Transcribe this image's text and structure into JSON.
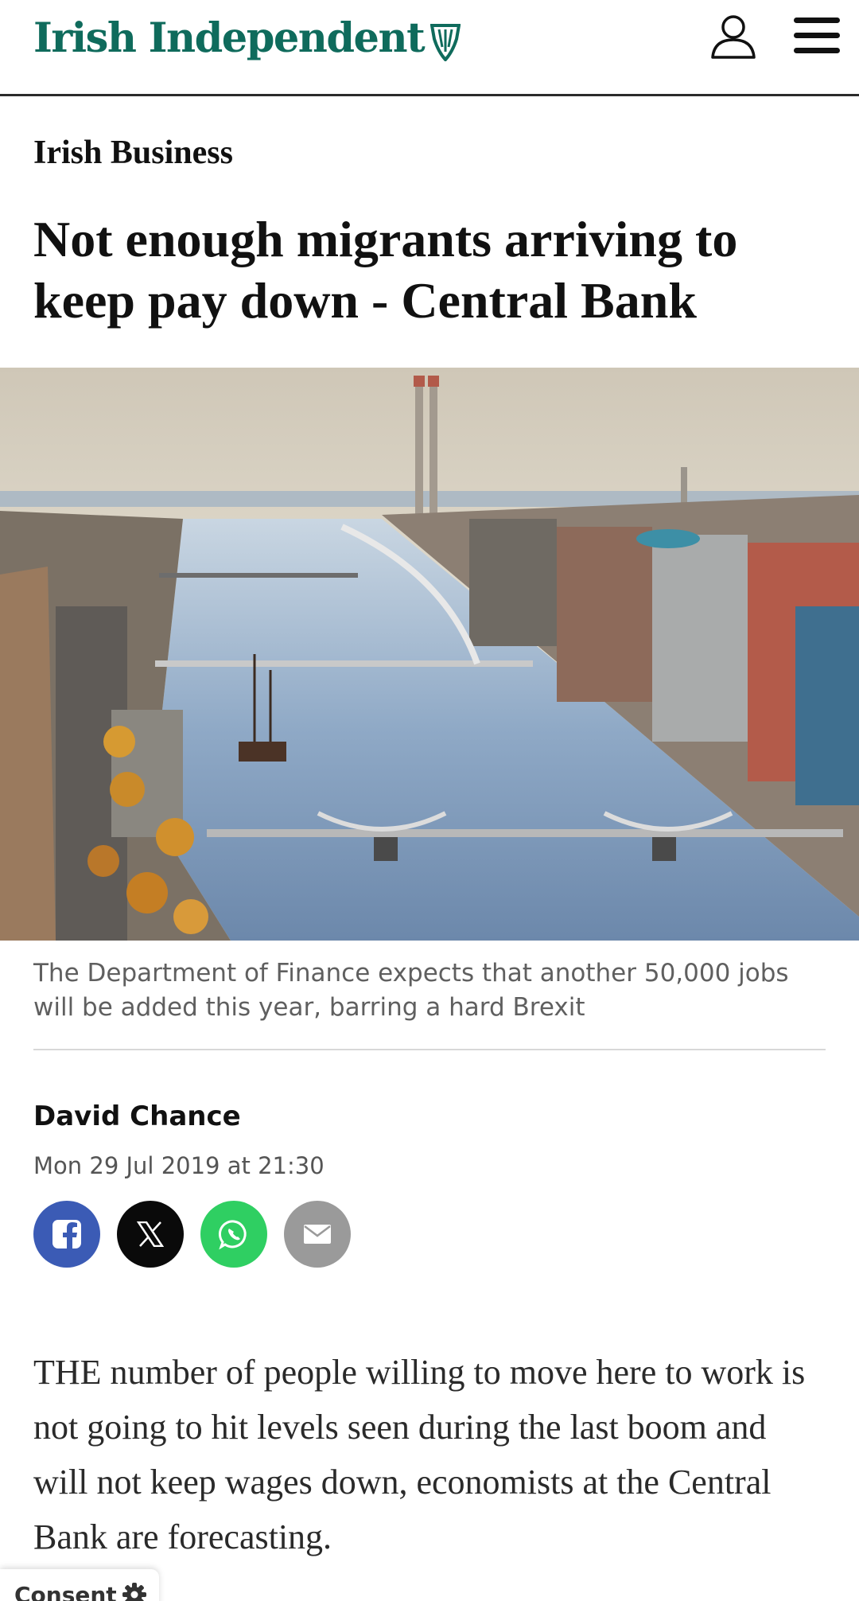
{
  "header": {
    "logo_text": "Irish Independent",
    "logo_color": "#0f6b5c",
    "account_icon": "user-icon",
    "menu_icon": "hamburger-menu-icon"
  },
  "article": {
    "section": "Irish Business",
    "headline": "Not enough migrants arriving to keep pay down - Central Bank",
    "image_caption": "The Department of Finance expects that another 50,000 jobs will be added this year, barring a hard Brexit",
    "author": "David Chance",
    "published": "Mon 29 Jul 2019 at 21:30",
    "body_first_paragraph": "THE number of people willing to move here to work is not going to hit levels seen during the last boom and will not keep wages down, economists at the Central Bank are forecasting."
  },
  "share": [
    {
      "icon": "facebook-icon",
      "color": "#3b5bb5"
    },
    {
      "icon": "x-icon",
      "color": "#0a0a0a"
    },
    {
      "icon": "whatsapp-icon",
      "color": "#2fcf62"
    },
    {
      "icon": "email-icon",
      "color": "#9a9a9a"
    }
  ],
  "consent": {
    "label": "Consent",
    "icon": "gear-icon"
  }
}
